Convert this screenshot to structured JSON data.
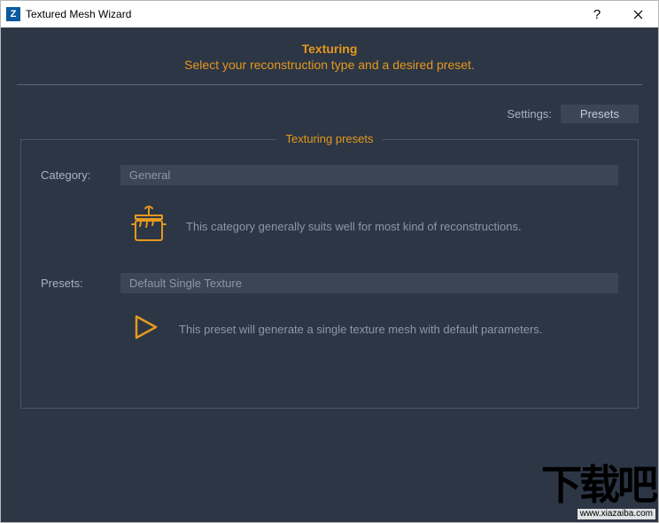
{
  "window": {
    "title": "Textured Mesh Wizard",
    "app_icon_letter": "Z"
  },
  "header": {
    "title": "Texturing",
    "subtitle": "Select your reconstruction type and a desired preset."
  },
  "settings": {
    "label": "Settings:",
    "button": "Presets"
  },
  "fieldset": {
    "legend": "Texturing presets",
    "category": {
      "label": "Category:",
      "value": "General",
      "description": "This category generally suits well for most kind of reconstructions."
    },
    "presets": {
      "label": "Presets:",
      "value": "Default Single Texture",
      "description": "This preset will generate a single texture mesh with default parameters."
    }
  },
  "watermark": {
    "text": "下载吧",
    "url": "www.xiazaiba.com"
  }
}
